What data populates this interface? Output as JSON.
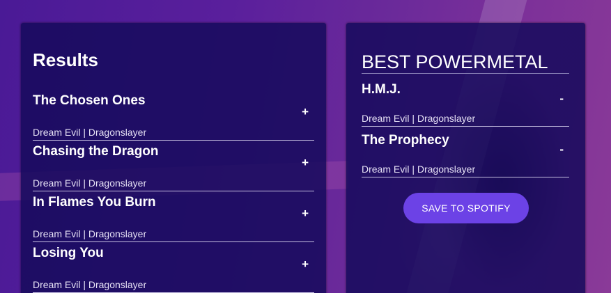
{
  "results": {
    "title": "Results",
    "tracks": [
      {
        "name": "The Chosen Ones",
        "info": "Dream Evil | Dragonslayer",
        "action": "+"
      },
      {
        "name": "Chasing the Dragon",
        "info": "Dream Evil | Dragonslayer",
        "action": "+"
      },
      {
        "name": "In Flames You Burn",
        "info": "Dream Evil | Dragonslayer",
        "action": "+"
      },
      {
        "name": "Losing You",
        "info": "Dream Evil | Dragonslayer",
        "action": "+"
      }
    ]
  },
  "playlist": {
    "name": "BEST POWERMETAL",
    "tracks": [
      {
        "name": "H.M.J.",
        "info": "Dream Evil | Dragonslayer",
        "action": "-"
      },
      {
        "name": "The Prophecy",
        "info": "Dream Evil | Dragonslayer",
        "action": "-"
      }
    ],
    "save_label": "SAVE TO SPOTIFY"
  },
  "colors": {
    "panel": "#160a5c",
    "button": "#6c42e6",
    "background": "#4a1a96"
  }
}
